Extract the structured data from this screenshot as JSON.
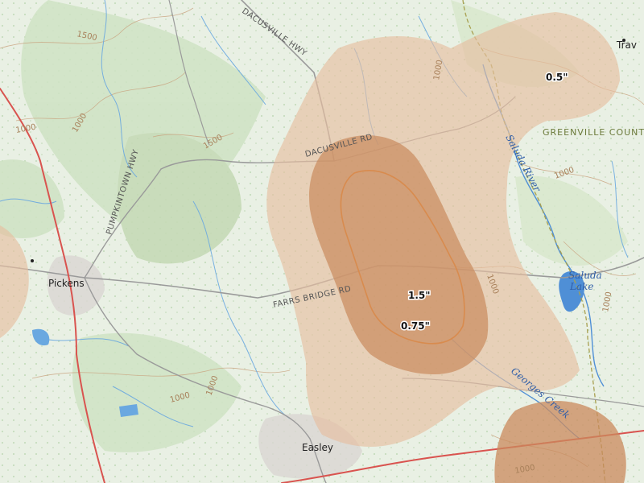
{
  "map": {
    "places": {
      "pickens": "Pickens",
      "easley": "Easley",
      "travelers_rest_partial": "Trav"
    },
    "roads": {
      "dacusville_hwy": "DACUSVILLE HWY",
      "dacusville_rd": "DACUSVILLE RD",
      "pumpkintown_hwy": "PUMPKINTOWN HWY",
      "farrs_bridge_rd": "FARRS BRIDGE RD"
    },
    "county": "GREENVILLE COUNT",
    "water": {
      "saluda_river": "Saluda River",
      "saluda_lake_line1": "Saluda",
      "saluda_lake_line2": "Lake",
      "georges_creek": "Georges Creek"
    },
    "contours": {
      "c1500_nw": "1500",
      "c1000_w": "1000",
      "c1500_center": "1500",
      "c1000_mid": "1000",
      "c1000_sw": "1000",
      "c1000_s": "1000",
      "c1000_se": "1000",
      "c1000_e": "1000",
      "c1000_ne": "1000",
      "c1000_far_e": "1000",
      "c1000_east_lake": "1000"
    },
    "hail_labels": {
      "large_outer": "0.5\"",
      "center_outer": "0.75\"",
      "center_inner": "1.5\""
    },
    "colors": {
      "base": "#e9f0e4",
      "forest": "#cfe3c4",
      "water": "#4f8fd6",
      "hail_light": "#e6bea0",
      "hail_mid": "#c98a5c",
      "hail_dark": "#b56b3a",
      "highway": "#d9534f"
    }
  }
}
